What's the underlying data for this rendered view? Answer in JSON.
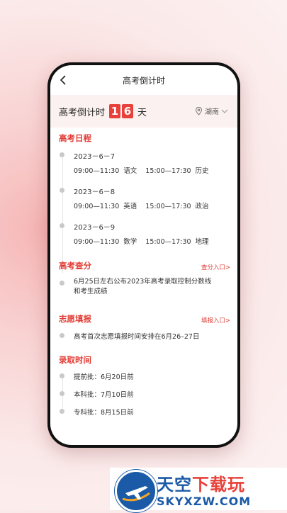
{
  "nav": {
    "title": "高考倒计时"
  },
  "countdown": {
    "label": "高考倒计时",
    "digit1": "1",
    "digit2": "6",
    "unit": "天",
    "region": "湖南"
  },
  "schedule": {
    "title": "高考日程",
    "days": [
      {
        "date": "2023－6－7",
        "am_time": "09:00—11:30",
        "am_subject": "语文",
        "pm_time": "15:00—17:30",
        "pm_subject": "历史"
      },
      {
        "date": "2023－6－8",
        "am_time": "09:00—11:30",
        "am_subject": "英语",
        "pm_time": "15:00—17:30",
        "pm_subject": "政治"
      },
      {
        "date": "2023－6－9",
        "am_time": "09:00—11:30",
        "am_subject": "数学",
        "pm_time": "15:00—17:30",
        "pm_subject": "地理"
      }
    ]
  },
  "score": {
    "title": "高考查分",
    "link": "查分入口>",
    "text": "6月25日左右公布2023年高考录取控制分数线和考生成绩"
  },
  "volunteer": {
    "title": "志愿填报",
    "link": "填报入口>",
    "text": "高考首次志愿填报时间安排在6月26–27日"
  },
  "admission": {
    "title": "录取时间",
    "items": [
      "提前批：6月20日前",
      "本科批：7月10日前",
      "专科批：8月15日前"
    ]
  },
  "watermark": {
    "main_a": "天空",
    "main_b": "下载玩",
    "sub": "SKYXZW.COM"
  }
}
